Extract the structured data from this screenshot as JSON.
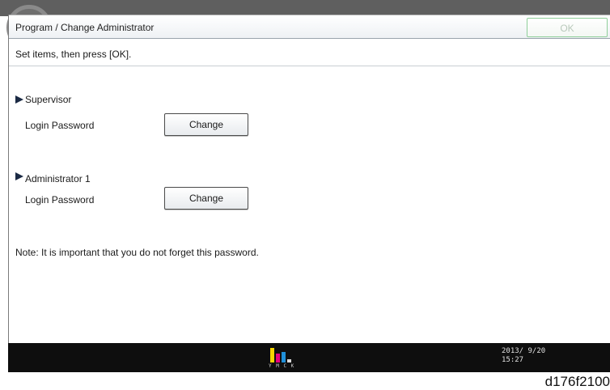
{
  "window": {
    "title": "Program / Change Administrator",
    "ok_label": "OK"
  },
  "instruction": "Set items, then press [OK].",
  "sections": [
    {
      "heading": "Supervisor",
      "field_label": "Login Password",
      "button_label": "Change"
    },
    {
      "heading": "Administrator 1",
      "field_label": "Login Password",
      "button_label": "Change"
    }
  ],
  "note": "Note: It is important that you do not forget this password.",
  "status_bar": {
    "toner_icon": "toner-level-icon",
    "toner_letters": "Y M C K",
    "toner_levels": [
      1.0,
      0.6,
      0.7,
      0.2
    ],
    "toner_colors": [
      "#f6d400",
      "#e6007e",
      "#1f8fd8",
      "#d9d9d9"
    ],
    "date": "2013/ 9/20",
    "time": "15:27"
  },
  "caption": "d176f2100",
  "colors": {
    "ok_border": "#8fcf9a",
    "section_marker": "#1b2a44",
    "status_bar": "#0e0e0e"
  }
}
